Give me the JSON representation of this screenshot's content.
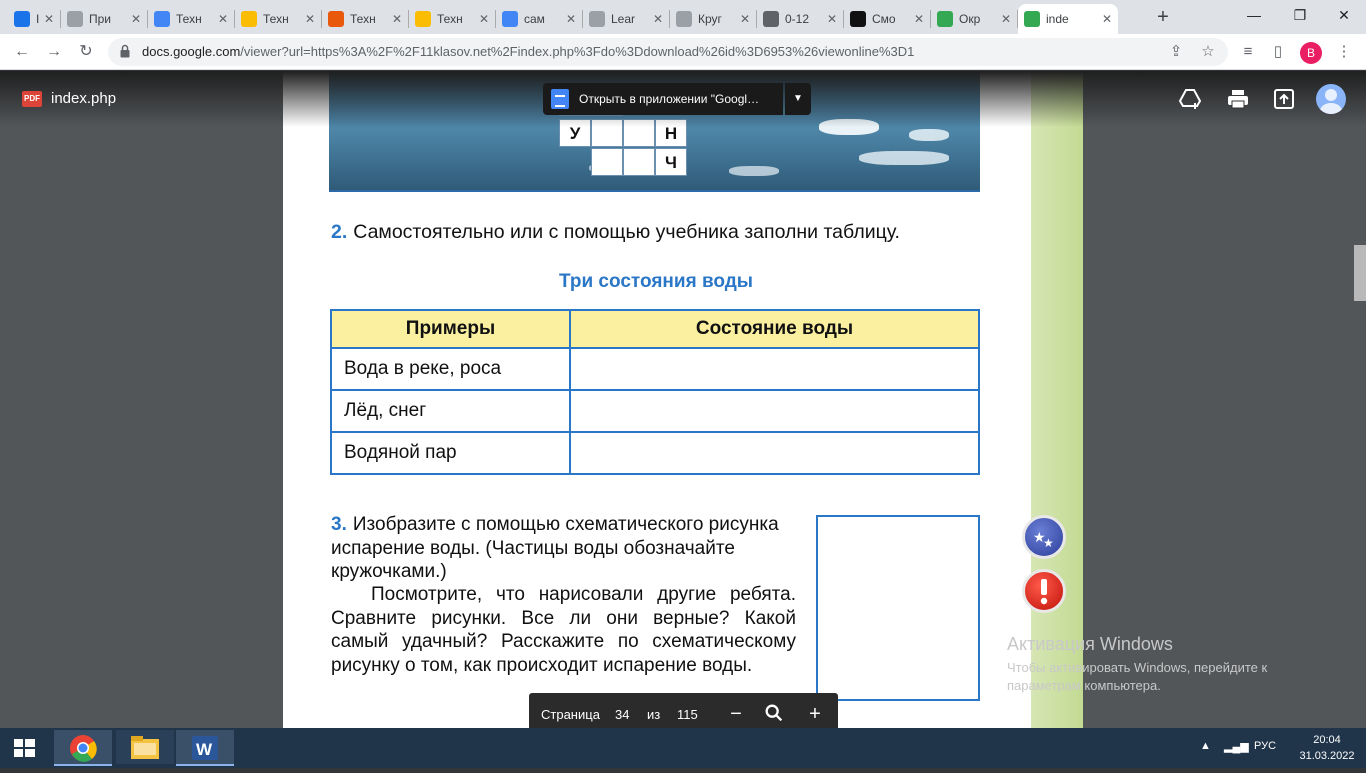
{
  "browser": {
    "tabs": [
      {
        "label": "I",
        "icon": "media-pause-icon",
        "color": "#1a73e8"
      },
      {
        "label": "При",
        "icon": "site-icon",
        "color": "#9aa0a6"
      },
      {
        "label": "Техн",
        "icon": "google-icon",
        "color": "#4285f4"
      },
      {
        "label": "Техн",
        "icon": "yellow-bar-icon",
        "color": "#fbbc04"
      },
      {
        "label": "Техн",
        "icon": "toolbox-icon",
        "color": "#e8590c"
      },
      {
        "label": "Техн",
        "icon": "yellow-bar-icon",
        "color": "#fbbc04"
      },
      {
        "label": "сам",
        "icon": "google-icon",
        "color": "#4285f4"
      },
      {
        "label": "Lear",
        "icon": "learn-icon",
        "color": "#9aa0a6"
      },
      {
        "label": "Круг",
        "icon": "learn-icon",
        "color": "#9aa0a6"
      },
      {
        "label": "0-12",
        "icon": "globe-icon",
        "color": "#5f6368"
      },
      {
        "label": "Смо",
        "icon": "play-icon",
        "color": "#111111"
      },
      {
        "label": "Окр",
        "icon": "book-icon",
        "color": "#34a853"
      },
      {
        "label": "inde",
        "icon": "google-drive-icon",
        "color": "#34a853",
        "active": true
      }
    ],
    "address": {
      "host": "docs.google.com",
      "path": "/viewer?url=https%3A%2F%2F11klasov.net%2Findex.php%3Fdo%3Ddownload%26id%3D6953%26viewonline%3D1"
    },
    "profile_initial": "B"
  },
  "viewer": {
    "file_name": "index.php",
    "pdf_badge": "PDF",
    "open_in_app_label": "Открыть в приложении \"Googl…",
    "pager": {
      "page_label": "Страница",
      "current": "34",
      "of_label": "из",
      "total": "115"
    }
  },
  "document": {
    "crossword_letters": [
      "У",
      "Н",
      "Ч"
    ],
    "task2": {
      "number": "2.",
      "text": "Самостоятельно или с помощью учебника заполни таблицу.",
      "table_title": "Три состояния воды",
      "headers": [
        "Примеры",
        "Состояние воды"
      ],
      "rows": [
        [
          "Вода в реке, роса",
          ""
        ],
        [
          "Лёд, снег",
          ""
        ],
        [
          "Водяной пар",
          ""
        ]
      ]
    },
    "task3": {
      "number": "3.",
      "text": "Изобразите с помощью схематического рисунка испарение воды. (Частицы воды обозначайте кружочками.)",
      "text2": "Посмотрите, что нарисовали другие ребята. Сравните рисунки. Все ли они верные? Какой самый удачный? Расскажите по схематическому рисунку о том, как происходит испарение воды."
    }
  },
  "windows_watermark": {
    "title": "Активация Windows",
    "subtitle": "Чтобы активировать Windows, перейдите к параметрам компьютера."
  },
  "taskbar": {
    "lang": "РУС",
    "time": "20:04",
    "date": "31.03.2022"
  }
}
